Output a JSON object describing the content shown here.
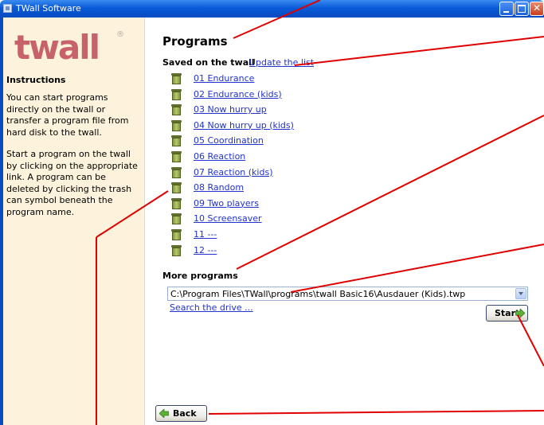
{
  "window": {
    "title": "TWall Software"
  },
  "sidebar": {
    "logo_text": "twall",
    "logo_mark": "®",
    "instructions_title": "Instructions",
    "paragraph1": "You can start programs directly on the twall or transfer a program file from hard disk to the twall.",
    "paragraph2": "Start a program on the twall by clicking on the appropriate link. A program can be deleted by clicking the trash can symbol beneath the program name."
  },
  "main": {
    "title": "Programs",
    "saved_label": "Saved on the twall",
    "update_link": "Update the list",
    "programs": [
      "01 Endurance",
      "02 Endurance (kids)",
      "03 Now hurry up",
      "04 Now hurry up (kids)",
      "05 Coordination",
      "06 Reaction",
      "07 Reaction (kids)",
      "08 Random",
      "09 Two players",
      "10 Screensaver",
      "11 ---",
      "12 ---"
    ],
    "more_label": "More programs",
    "selected_path": "C:\\Program Files\\TWall\\programs\\twall Basic16\\Ausdauer (Kids).twp",
    "search_link": "Search the drive ...",
    "start_label": "Start",
    "back_label": "Back"
  },
  "colors": {
    "link": "#2233cc",
    "sidebar_bg": "#fdf3dc",
    "logo": "#c7626b",
    "annotation": "#e00000",
    "trash_icon": "#7f9440",
    "arrow_icon": "#5bb03a"
  }
}
